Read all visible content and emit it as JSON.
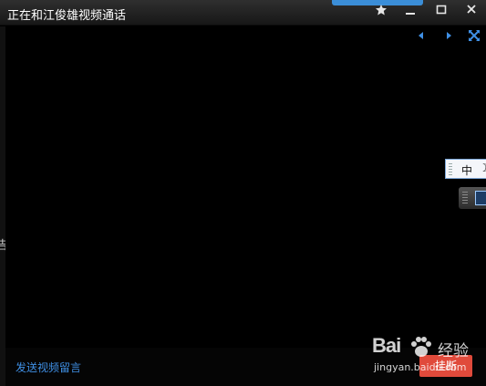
{
  "window": {
    "title": "正在和江俊雄视频通话",
    "accent_color": "#3b8ed8"
  },
  "titlebar_buttons": [
    {
      "name": "pin-icon"
    },
    {
      "name": "minimize-icon"
    },
    {
      "name": "maximize-icon"
    },
    {
      "name": "close-icon"
    }
  ],
  "video_controls": {
    "prev_icon": "triangle-left-icon",
    "next_icon": "triangle-right-icon",
    "fullscreen_icon": "expand-arrows-icon"
  },
  "left_edge_text": "告",
  "ime": {
    "language": "中",
    "mode_icon": "moon-icon"
  },
  "bottom": {
    "leave_message_link": "发送视频留言",
    "hangup_label": "挂断",
    "hangup_color": "#e04a3b"
  },
  "watermark": {
    "brand": "Bai",
    "brand_suffix": "经验",
    "url": "jingyan.baidu.com"
  }
}
